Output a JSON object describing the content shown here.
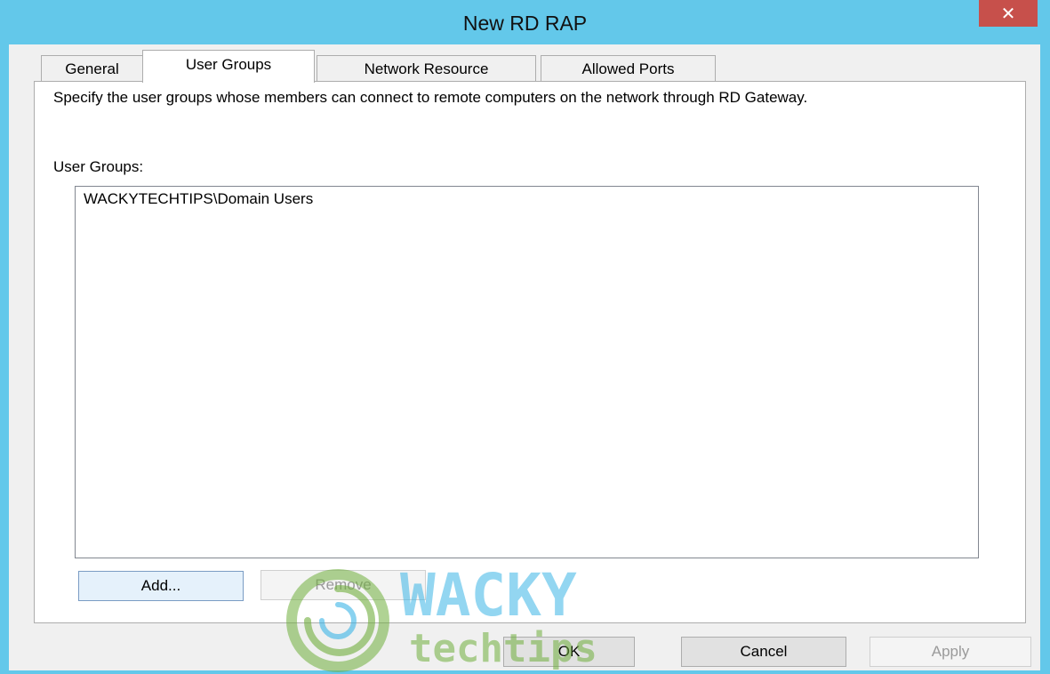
{
  "window": {
    "title": "New RD RAP",
    "close_glyph": "✕"
  },
  "tabs": [
    {
      "label": "General",
      "active": false
    },
    {
      "label": "User Groups",
      "active": true
    },
    {
      "label": "Network Resource",
      "active": false
    },
    {
      "label": "Allowed Ports",
      "active": false
    }
  ],
  "panel": {
    "description": "Specify the user groups whose members can connect to remote computers on the network through RD Gateway.",
    "groups_label": "User Groups:",
    "groups": [
      "WACKYTECHTIPS\\Domain Users"
    ],
    "add_label": "Add...",
    "remove_label": "Remove"
  },
  "footer": {
    "ok_label": "OK",
    "cancel_label": "Cancel",
    "apply_label": "Apply"
  },
  "watermark": {
    "word1": "WACKY",
    "word2": "techtips"
  },
  "colors": {
    "titlebar": "#63c8ea",
    "close": "#c7504b",
    "watermark_blue": "#3bb4e6",
    "watermark_green": "#6fae3c"
  }
}
